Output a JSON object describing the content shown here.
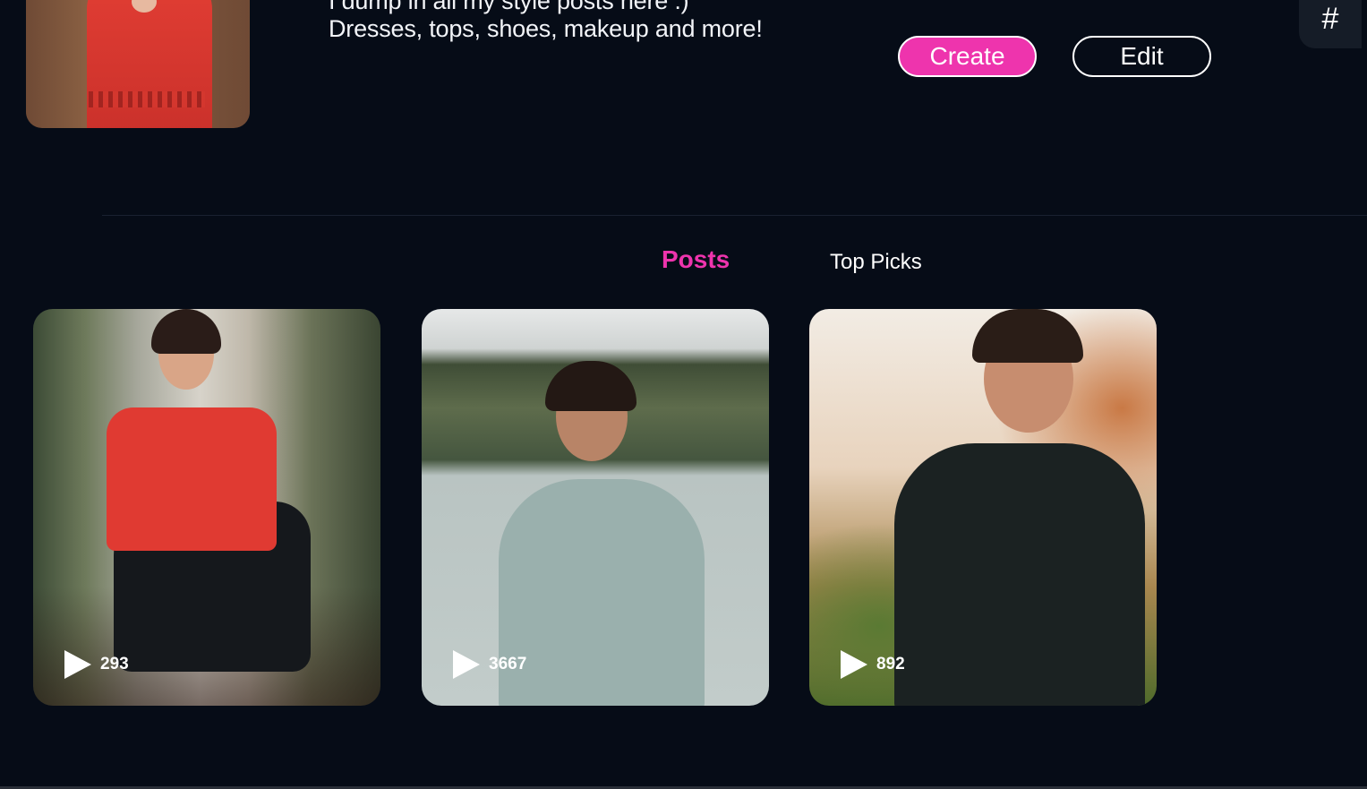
{
  "profile": {
    "bio_line_1": "I dump in all my style posts here :)",
    "bio_line_2": "Dresses, tops, shoes, makeup and more!",
    "create_label": "Create",
    "edit_label": "Edit",
    "hash_symbol": "#"
  },
  "tabs": [
    {
      "label": "Posts",
      "active": true
    },
    {
      "label": "Top Picks",
      "active": false
    }
  ],
  "posts": [
    {
      "views": "293"
    },
    {
      "views": "3667"
    },
    {
      "views": "892"
    }
  ],
  "colors": {
    "background": "#060c17",
    "accent": "#ee34ad",
    "text": "#ffffff"
  },
  "icons": {
    "play": "play-icon",
    "hash": "hashtag-icon"
  }
}
